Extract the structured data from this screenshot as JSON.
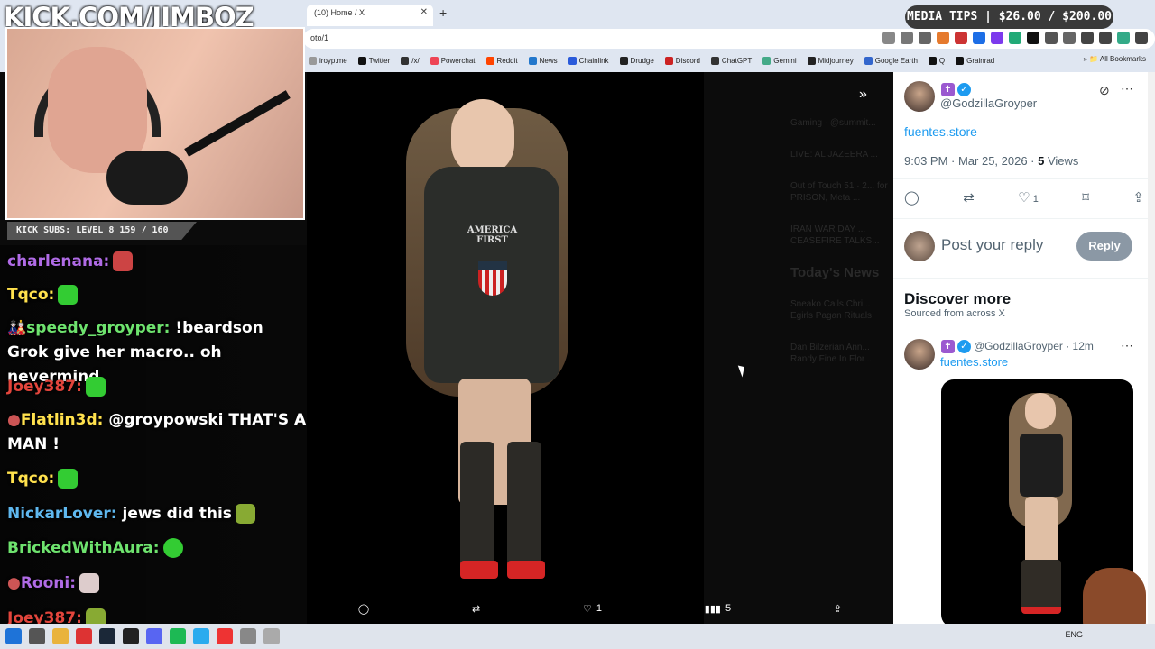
{
  "browser": {
    "tab_title": "(10) Home / X",
    "url": "oto/1",
    "bookmarks": [
      "iroyp.me",
      "Twitter",
      "/x/",
      "Powerchat",
      "Reddit",
      "News",
      "Chainlink",
      "Drudge",
      "Discord",
      "ChatGPT",
      "Gemini",
      "Midjourney",
      "Google Earth",
      "Q",
      "Grainrad"
    ],
    "all_bookmarks": "All Bookmarks"
  },
  "viewer": {
    "hoodie_text": "AMERICA FIRST",
    "actions": {
      "reply": "",
      "retweet": "",
      "likes": "1",
      "views": "5",
      "share": ""
    },
    "bg_news": [
      "Gaming · @summit...",
      "LIVE: AL JAZEERA ...",
      "Out of Touch 51 · 2... for PRISON, Meta ...",
      "IRAN WAR DAY ... CEASEFIRE TALKS...",
      "Today's News",
      "Sneako Calls Chri... Egirls Pagan Rituals",
      "Dan Bilzerian Ann... Randy Fine In Flor..."
    ]
  },
  "tweet": {
    "handle": "@GodzillaGroyper",
    "link": "fuentes.store",
    "time": "9:03 PM · Mar 25, 2026 · ",
    "views_count": "5",
    "views_label": " Views",
    "likes": "1",
    "reply_placeholder": "Post your reply",
    "reply_button": "Reply"
  },
  "discover": {
    "title": "Discover more",
    "subtitle": "Sourced from across X",
    "post": {
      "handle": "@GodzillaGroyper · 12m",
      "link": "fuentes.store"
    }
  },
  "stream": {
    "logo": "KICK.COM/JIMBOZ",
    "subs": "KICK SUBS: LEVEL 8 159 / 160",
    "media_tips": "MEDIA TIPS | $26.00 / $200.00",
    "chat": [
      {
        "user": "charlenana:",
        "color": "#b06be6",
        "text": ""
      },
      {
        "user": "Tqco:",
        "color": "#ffe14d",
        "text": ""
      },
      {
        "user": "speedy_groyper:",
        "color": "#6ee36e",
        "text": "!beardson Grok give her macro.. oh nevermind"
      },
      {
        "user": "Joey387:",
        "color": "#e2453c",
        "text": ""
      },
      {
        "user": "Flatlin3d:",
        "color": "#ffe14d",
        "text": "@groypowski THAT'S A MAN !"
      },
      {
        "user": "Tqco:",
        "color": "#ffe14d",
        "text": ""
      },
      {
        "user": "NickarLover:",
        "color": "#5fb8ef",
        "text": "jews did this"
      },
      {
        "user": "BrickedWithAura:",
        "color": "#6ee36e",
        "text": ""
      },
      {
        "user": "Rooni:",
        "color": "#b06be6",
        "text": ""
      },
      {
        "user": "Joey387:",
        "color": "#e2453c",
        "text": ""
      }
    ]
  },
  "taskbar": {
    "lang": "ENG"
  }
}
